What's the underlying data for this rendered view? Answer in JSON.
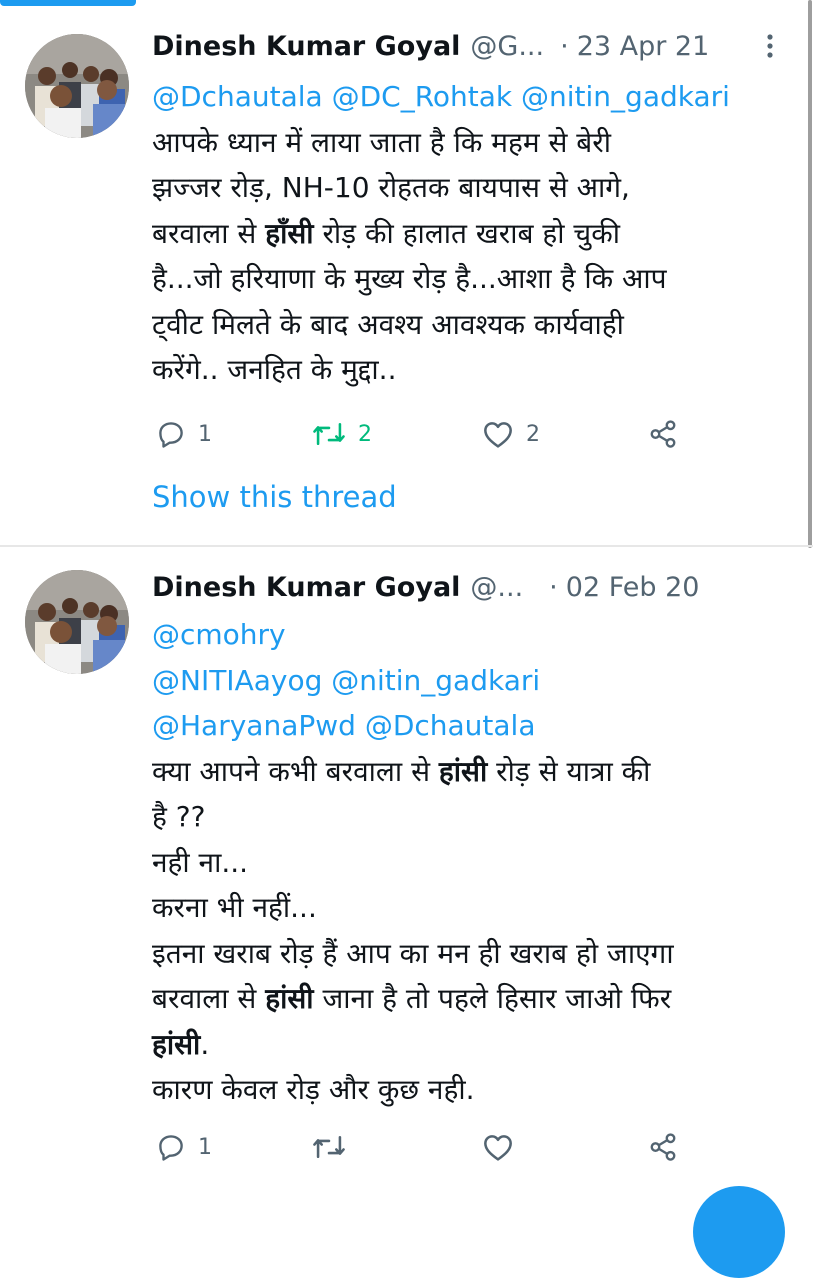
{
  "tweets": [
    {
      "author_name": "Dinesh Kumar Goyal",
      "author_handle": "@G...",
      "separator": "·",
      "date": "23 Apr 21",
      "mentions_line": "@Dchautala @DC_Rohtak @nitin_gadkari",
      "text": {
        "l1": "आपके ध्यान में लाया जाता है कि महम से बेरी",
        "l2": "झज्जर रोड़, NH-10 रोहतक बायपास से आगे,",
        "l3_pre": "बरवाला से ",
        "l3_bold": "हाँसी",
        "l3_post": " रोड़ की हालात खराब हो चुकी",
        "l4": "है...जो हरियाणा के मुख्य रोड़ है...आशा है कि आप",
        "l5": "ट्वीट मिलते के बाद अवश्य आवश्यक कार्यवाही",
        "l6": "करेंगे.. जनहित के मुद्दा.."
      },
      "reply_count": "1",
      "retweet_count": "2",
      "like_count": "2",
      "show_thread": "Show this thread"
    },
    {
      "author_name": "Dinesh Kumar Goyal",
      "author_handle": "@...",
      "separator": "·",
      "date": "02 Feb 20",
      "mention_1": "@cmohry",
      "mention_2": "@NITIAayog @nitin_gadkari",
      "mention_3": "@HaryanaPwd @Dchautala",
      "text": {
        "l1_pre": "क्या आपने कभी बरवाला से ",
        "l1_bold": "हांसी",
        "l1_post": " रोड़ से यात्रा की",
        "l2": "है ??",
        "l3": "नही ना...",
        "l4": "करना भी नहीं...",
        "l5": "इतना खराब रोड़  हैं आप का मन ही खराब हो जाएगा",
        "l6_pre": "बरवाला से ",
        "l6_bold": "हांसी",
        "l6_post": " जाना है तो पहले हिसार जाओ फिर",
        "l7_bold": "हांसी",
        "l7_post": ".",
        "l8": "कारण केवल रोड़ और कुछ नही."
      },
      "reply_count": "1"
    }
  ],
  "icons": [
    "more-icon",
    "reply-icon",
    "retweet-icon",
    "like-icon",
    "share-icon"
  ],
  "colors": {
    "accent": "#1d9bf0",
    "retweet_active": "#00ba7c",
    "muted": "#536471",
    "text": "#0f1419"
  }
}
